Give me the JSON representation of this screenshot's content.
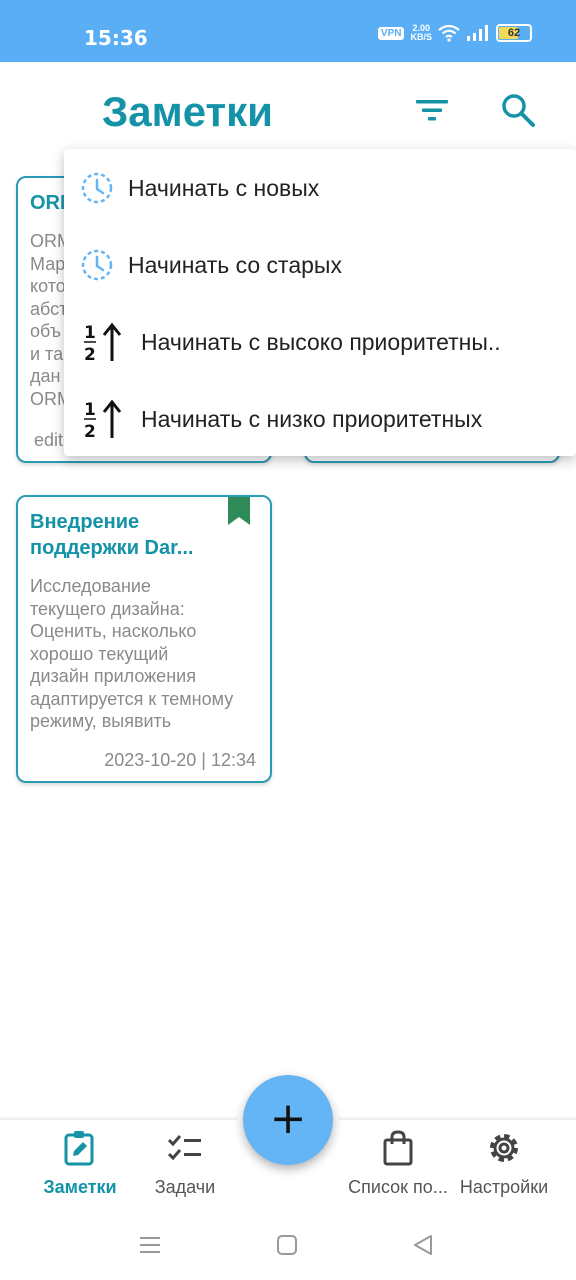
{
  "status_bar": {
    "time": "15:36",
    "vpn": "VPN",
    "speed_value": "2.00",
    "speed_unit": "KB/S",
    "battery": "62"
  },
  "header": {
    "title": "Заметки",
    "filter_icon": "filter-icon",
    "search_icon": "search-icon"
  },
  "notes": [
    {
      "title": "ORM",
      "body": [
        "ORM",
        "Мар",
        "кото",
        "абст",
        "объ",
        "и та",
        "дан",
        "ORM"
      ],
      "footer": "edit"
    },
    {
      "title": "Внедрение поддержки Dar...",
      "body": [
        "Исследование",
        "текущего дизайна:",
        "Оценить, насколько",
        "хорошо текущий",
        "дизайн приложения",
        "адаптируется к темному",
        "режиму, выявить"
      ],
      "date": "2023-10-20 | 12:34",
      "bookmarked": true
    }
  ],
  "sort_menu": {
    "items": [
      {
        "label": "Начинать с новых",
        "icon": "clock-icon"
      },
      {
        "label": "Начинать со старых",
        "icon": "clock-icon"
      },
      {
        "label": "Начинать с высоко приоритетны..",
        "icon": "priority-sort-icon"
      },
      {
        "label": "Начинать с низко приоритетных",
        "icon": "priority-sort-icon"
      }
    ]
  },
  "bottom_nav": {
    "items": [
      {
        "label": "Заметки",
        "icon": "notes-icon",
        "active": true
      },
      {
        "label": "Задачи",
        "icon": "tasks-icon"
      },
      {
        "label": "Список по...",
        "icon": "shopping-bag-icon"
      },
      {
        "label": "Настройки",
        "icon": "gear-icon"
      }
    ],
    "fab": "+"
  },
  "colors": {
    "accent": "#1493a8",
    "status_bar": "#5aaef5",
    "fab": "#64b5f6",
    "bookmark": "#2e8b57"
  }
}
